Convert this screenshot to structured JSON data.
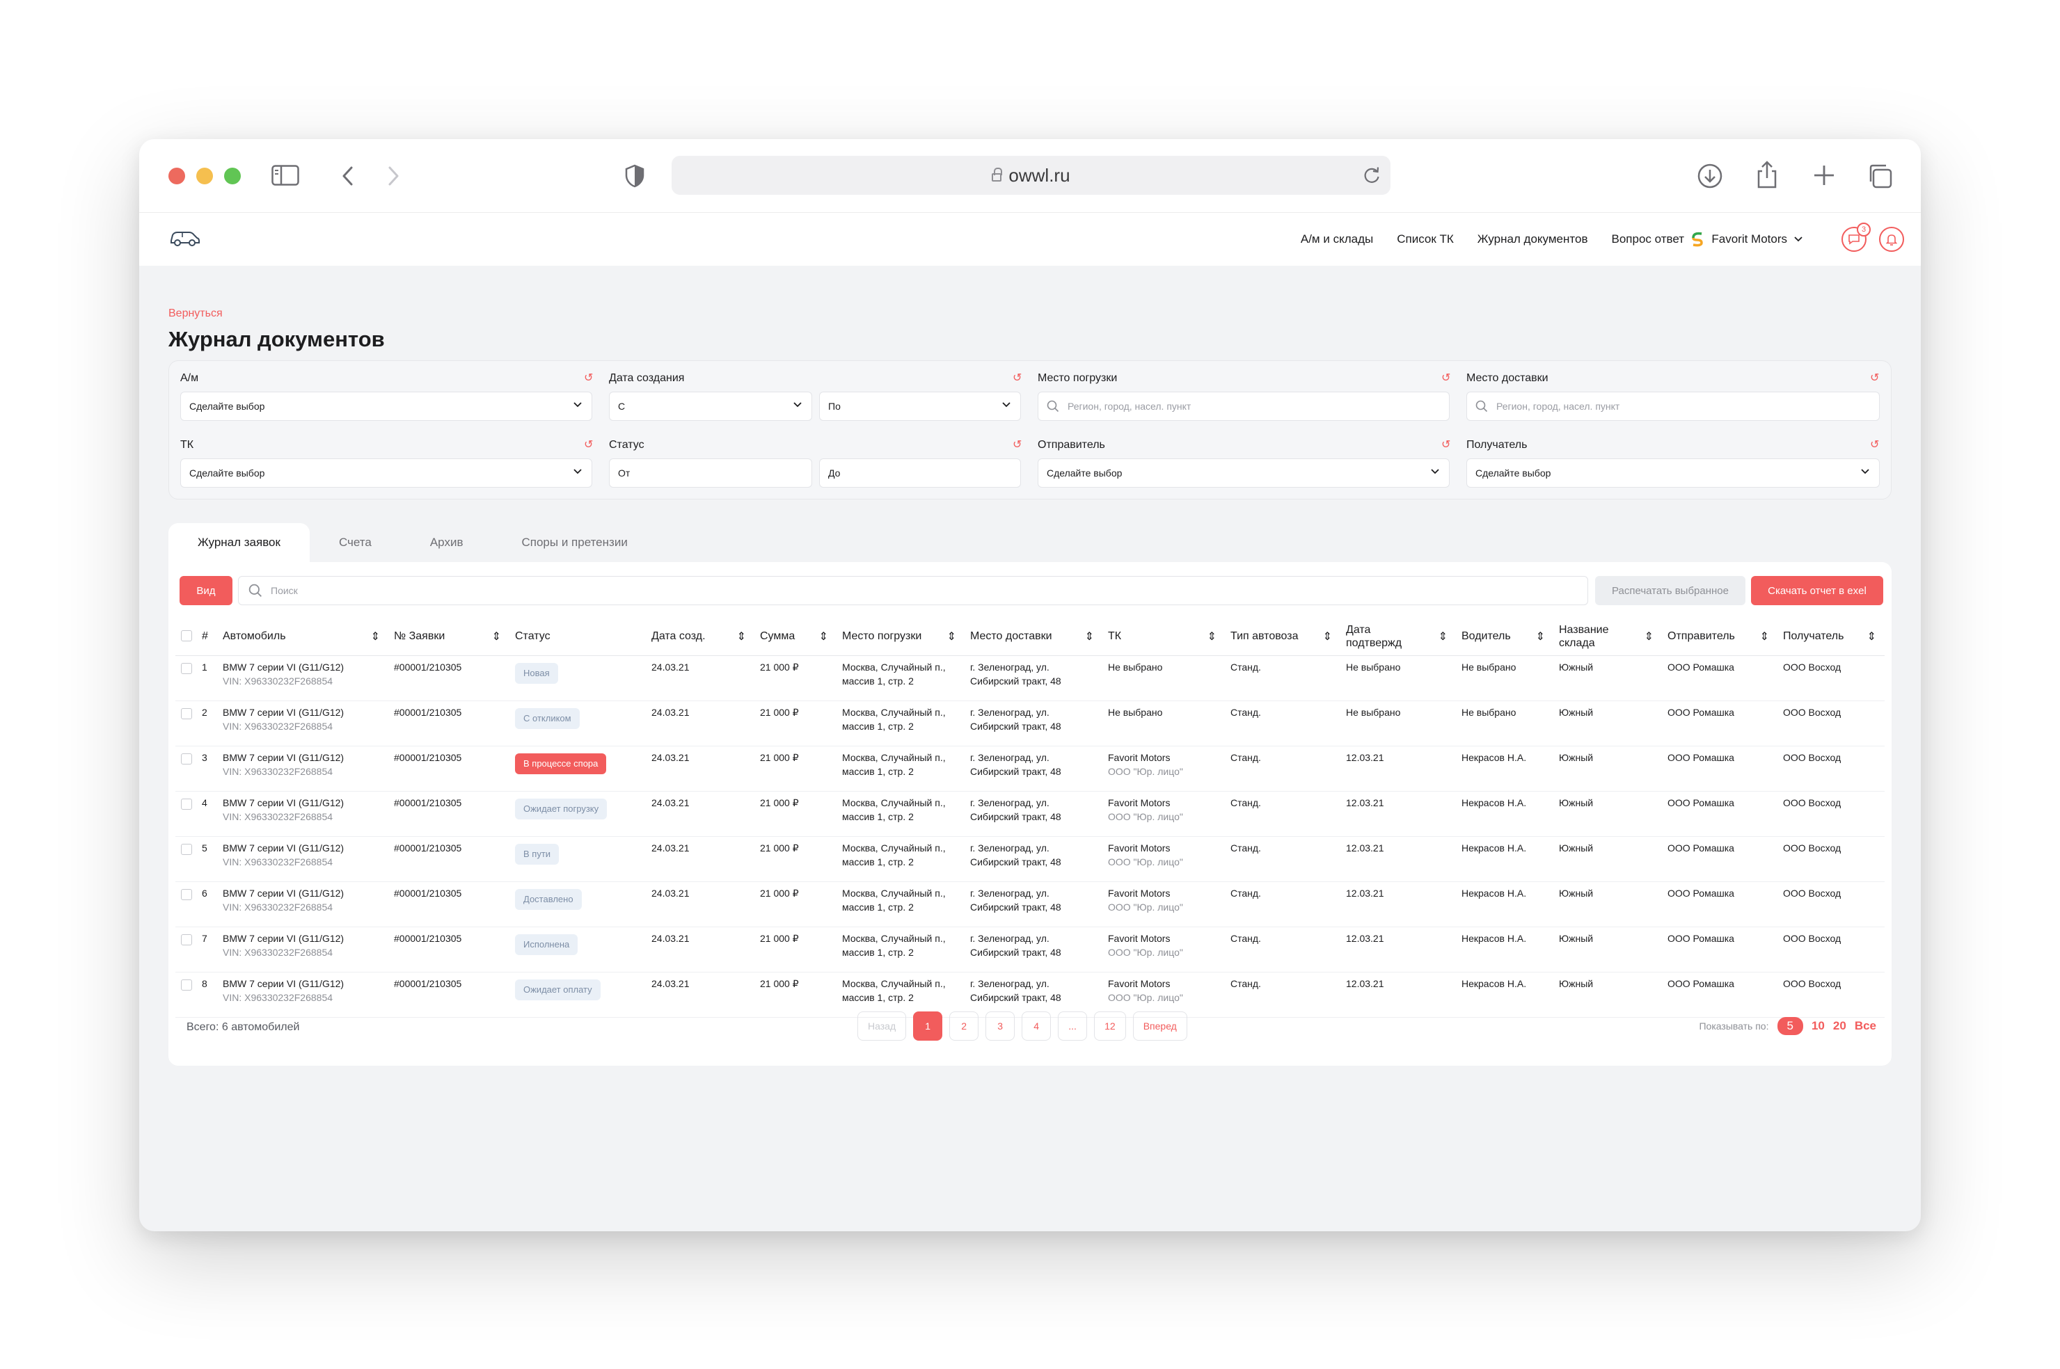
{
  "browser": {
    "url": "owwl.ru",
    "colors": {
      "close": "#ed6a5e",
      "minimize": "#f5bf4f",
      "maximize": "#61c554"
    }
  },
  "nav": {
    "links": [
      "А/м и склады",
      "Список ТК",
      "Журнал документов",
      "Вопрос ответ"
    ],
    "company": "Favorit Motors",
    "messages_count": "3"
  },
  "page": {
    "back_label": "Вернуться",
    "title": "Журнал документов"
  },
  "filters": {
    "car": {
      "label": "А/м",
      "value": "Сделайте выбор"
    },
    "created": {
      "label": "Дата создания",
      "from": "С",
      "to": "По"
    },
    "loading": {
      "label": "Место погрузки",
      "placeholder": "Регион, город, насел. пункт"
    },
    "delivery": {
      "label": "Место доставки",
      "placeholder": "Регион, город, насел. пункт"
    },
    "tk": {
      "label": "ТК",
      "value": "Сделайте выбор"
    },
    "status": {
      "label": "Статус",
      "from": "От",
      "to": "До"
    },
    "sender": {
      "label": "Отправитель",
      "value": "Сделайте выбор"
    },
    "receiver": {
      "label": "Получатель",
      "value": "Сделайте выбор"
    }
  },
  "tabs": [
    "Журнал заявок",
    "Счета",
    "Архив",
    "Споры и претензии"
  ],
  "toolbar": {
    "view_label": "Вид",
    "search_placeholder": "Поиск",
    "print_label": "Распечатать выбранное",
    "export_label": "Скачать отчет в exel"
  },
  "table": {
    "headers": [
      "#",
      "Автомобиль",
      "№ Заявки",
      "Статус",
      "Дата созд.",
      "Сумма",
      "Место погрузки",
      "Место доставки",
      "ТК",
      "Тип автовоза",
      "Дата подтвержд",
      "Водитель",
      "Название склада",
      "Отправитель",
      "Получатель"
    ],
    "rows": [
      {
        "n": "1",
        "car": "BMW 7 серии VI (G11/G12)",
        "vin": "VIN: X96330232F268854",
        "order": "#00001/210305",
        "status": "Новая",
        "status_type": "default",
        "created": "24.03.21",
        "sum": "21 000 ₽",
        "loading_1": "Москва, Случайный п.,",
        "loading_2": "массив 1, стр. 2",
        "delivery_1": "г. Зеленоград, ул.",
        "delivery_2": "Сибирский тракт, 48",
        "tk": "Не выбрано",
        "tk_sub": "",
        "carrier": "Станд.",
        "confirmed": "Не выбрано",
        "driver": "Не выбрано",
        "warehouse": "Южный",
        "sender": "ООО Ромашка",
        "receiver": "ООО Восход"
      },
      {
        "n": "2",
        "car": "BMW 7 серии VI (G11/G12)",
        "vin": "VIN: X96330232F268854",
        "order": "#00001/210305",
        "status": "С откликом",
        "status_type": "default",
        "created": "24.03.21",
        "sum": "21 000 ₽",
        "loading_1": "Москва, Случайный п.,",
        "loading_2": "массив 1, стр. 2",
        "delivery_1": "г. Зеленоград, ул.",
        "delivery_2": "Сибирский тракт, 48",
        "tk": "Не выбрано",
        "tk_sub": "",
        "carrier": "Станд.",
        "confirmed": "Не выбрано",
        "driver": "Не выбрано",
        "warehouse": "Южный",
        "sender": "ООО Ромашка",
        "receiver": "ООО Восход"
      },
      {
        "n": "3",
        "car": "BMW 7 серии VI (G11/G12)",
        "vin": "VIN: X96330232F268854",
        "order": "#00001/210305",
        "status": "В процессе спора",
        "status_type": "dispute",
        "created": "24.03.21",
        "sum": "21 000 ₽",
        "loading_1": "Москва, Случайный п.,",
        "loading_2": "массив 1, стр. 2",
        "delivery_1": "г. Зеленоград, ул.",
        "delivery_2": "Сибирский тракт, 48",
        "tk": "Favorit Motors",
        "tk_sub": "ООО \"Юр. лицо\"",
        "carrier": "Станд.",
        "confirmed": "12.03.21",
        "driver": "Некрасов Н.А.",
        "warehouse": "Южный",
        "sender": "ООО Ромашка",
        "receiver": "ООО Восход"
      },
      {
        "n": "4",
        "car": "BMW 7 серии VI (G11/G12)",
        "vin": "VIN: X96330232F268854",
        "order": "#00001/210305",
        "status": "Ожидает погрузку",
        "status_type": "default",
        "created": "24.03.21",
        "sum": "21 000 ₽",
        "loading_1": "Москва, Случайный п.,",
        "loading_2": "массив 1, стр. 2",
        "delivery_1": "г. Зеленоград, ул.",
        "delivery_2": "Сибирский тракт, 48",
        "tk": "Favorit Motors",
        "tk_sub": "ООО \"Юр. лицо\"",
        "carrier": "Станд.",
        "confirmed": "12.03.21",
        "driver": "Некрасов Н.А.",
        "warehouse": "Южный",
        "sender": "ООО Ромашка",
        "receiver": "ООО Восход"
      },
      {
        "n": "5",
        "car": "BMW 7 серии VI (G11/G12)",
        "vin": "VIN: X96330232F268854",
        "order": "#00001/210305",
        "status": "В пути",
        "status_type": "default",
        "created": "24.03.21",
        "sum": "21 000 ₽",
        "loading_1": "Москва, Случайный п.,",
        "loading_2": "массив 1, стр. 2",
        "delivery_1": "г. Зеленоград, ул.",
        "delivery_2": "Сибирский тракт, 48",
        "tk": "Favorit Motors",
        "tk_sub": "ООО \"Юр. лицо\"",
        "carrier": "Станд.",
        "confirmed": "12.03.21",
        "driver": "Некрасов Н.А.",
        "warehouse": "Южный",
        "sender": "ООО Ромашка",
        "receiver": "ООО Восход"
      },
      {
        "n": "6",
        "car": "BMW 7 серии VI (G11/G12)",
        "vin": "VIN: X96330232F268854",
        "order": "#00001/210305",
        "status": "Доставлено",
        "status_type": "default",
        "created": "24.03.21",
        "sum": "21 000 ₽",
        "loading_1": "Москва, Случайный п.,",
        "loading_2": "массив 1, стр. 2",
        "delivery_1": "г. Зеленоград, ул.",
        "delivery_2": "Сибирский тракт, 48",
        "tk": "Favorit Motors",
        "tk_sub": "ООО \"Юр. лицо\"",
        "carrier": "Станд.",
        "confirmed": "12.03.21",
        "driver": "Некрасов Н.А.",
        "warehouse": "Южный",
        "sender": "ООО Ромашка",
        "receiver": "ООО Восход"
      },
      {
        "n": "7",
        "car": "BMW 7 серии VI (G11/G12)",
        "vin": "VIN: X96330232F268854",
        "order": "#00001/210305",
        "status": "Исполнена",
        "status_type": "default",
        "created": "24.03.21",
        "sum": "21 000 ₽",
        "loading_1": "Москва, Случайный п.,",
        "loading_2": "массив 1, стр. 2",
        "delivery_1": "г. Зеленоград, ул.",
        "delivery_2": "Сибирский тракт, 48",
        "tk": "Favorit Motors",
        "tk_sub": "ООО \"Юр. лицо\"",
        "carrier": "Станд.",
        "confirmed": "12.03.21",
        "driver": "Некрасов Н.А.",
        "warehouse": "Южный",
        "sender": "ООО Ромашка",
        "receiver": "ООО Восход"
      },
      {
        "n": "8",
        "car": "BMW 7 серии VI (G11/G12)",
        "vin": "VIN: X96330232F268854",
        "order": "#00001/210305",
        "status": "Ожидает оплату",
        "status_type": "default",
        "created": "24.03.21",
        "sum": "21 000 ₽",
        "loading_1": "Москва, Случайный п.,",
        "loading_2": "массив 1, стр. 2",
        "delivery_1": "г. Зеленоград, ул.",
        "delivery_2": "Сибирский тракт, 48",
        "tk": "Favorit Motors",
        "tk_sub": "ООО \"Юр. лицо\"",
        "carrier": "Станд.",
        "confirmed": "12.03.21",
        "driver": "Некрасов Н.А.",
        "warehouse": "Южный",
        "sender": "ООО Ромашка",
        "receiver": "ООО Восход"
      }
    ]
  },
  "footer": {
    "total": "Всего: 6 автомобилей",
    "pages": [
      "Назад",
      "1",
      "2",
      "3",
      "4",
      "...",
      "12",
      "Вперед"
    ],
    "active_page": "1",
    "per_page_label": "Показывать по:",
    "per_page_options": [
      "5",
      "10",
      "20",
      "Все"
    ],
    "per_page_active": "5"
  },
  "colors": {
    "accent": "#f25c5c",
    "background": "#f2f3f5",
    "status_bg": "#eaf0f7"
  }
}
